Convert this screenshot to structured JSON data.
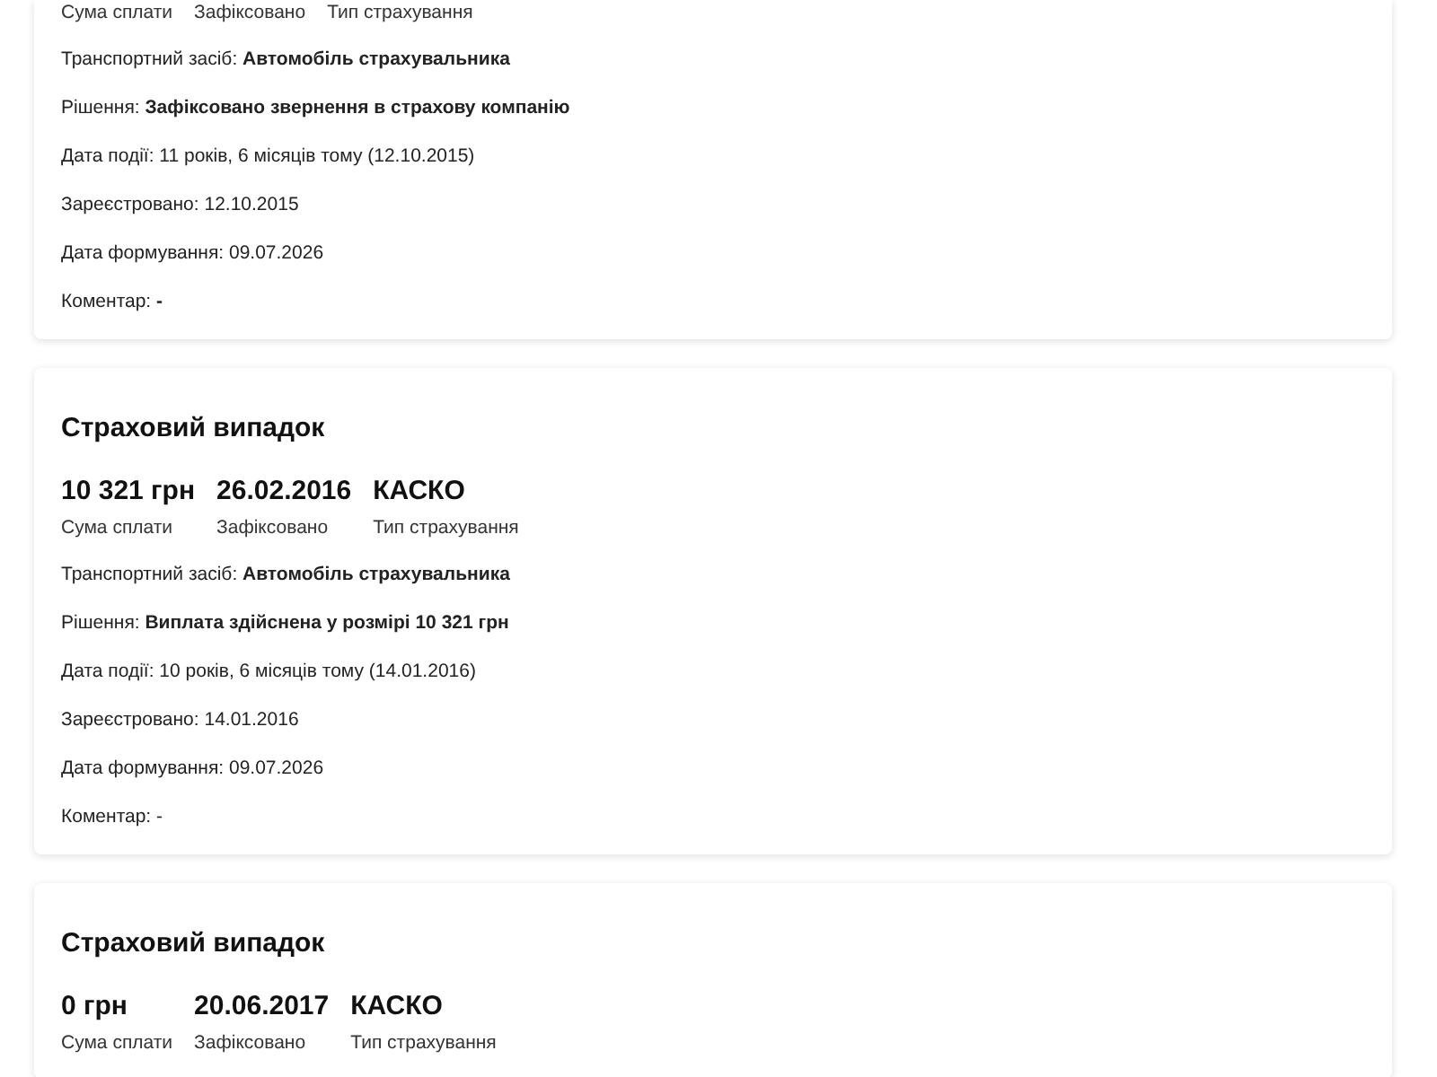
{
  "cases": [
    {
      "stats": [
        {
          "label": "Сума сплати"
        },
        {
          "label": "Зафіксовано"
        },
        {
          "label": "Тип страхування"
        }
      ],
      "details": [
        "Транспортний засіб: **Автомобіль страхувальника**",
        "Рішення: **Зафіксовано звернення в страхову компанію**",
        "Дата події: 11 років, 6 місяців тому (12.10.2015)",
        "Зареєстровано: 12.10.2015",
        "Дата формування: 09.07.2026",
        "Коментар: **-**"
      ]
    },
    {
      "title": "Страховий випадок",
      "stats": [
        {
          "value": "10 321 грн",
          "label": "Сума сплати"
        },
        {
          "value": "26.02.2016",
          "label": "Зафіксовано"
        },
        {
          "value": "КАСКО",
          "label": "Тип страхування"
        }
      ],
      "details": [
        "Транспортний засіб: **Автомобіль страхувальника**",
        "Рішення: **Виплата здійснена у розмірі 10 321 грн**",
        "Дата події: 10 років, 6 місяців тому (14.01.2016)",
        "Зареєстровано: 14.01.2016",
        "Дата формування: 09.07.2026",
        "Коментар: -"
      ]
    },
    {
      "title": "Страховий випадок",
      "stats": [
        {
          "value": "0 грн",
          "label": "Сума сплати"
        },
        {
          "value": "20.06.2017",
          "label": "Зафіксовано"
        },
        {
          "value": "КАСКО",
          "label": "Тип страхування"
        }
      ]
    }
  ]
}
